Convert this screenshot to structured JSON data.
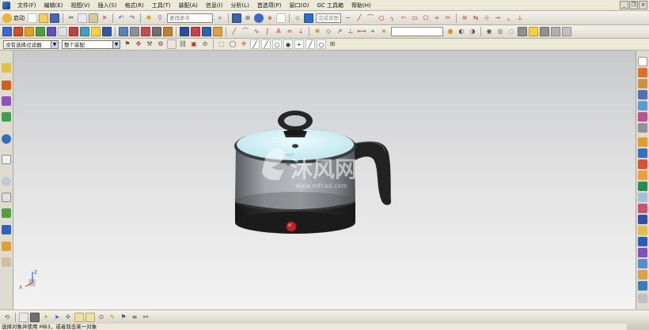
{
  "menubar": {
    "items": [
      "文件(F)",
      "编辑(E)",
      "视图(V)",
      "插入(S)",
      "格式(R)",
      "工具(T)",
      "装配(A)",
      "信息(I)",
      "分析(L)",
      "首选项(P)",
      "窗口(O)",
      "GC 工具箱",
      "帮助(H)"
    ]
  },
  "toolbar1": {
    "start_label": "启动",
    "search_placeholder": "查找命令",
    "sketch_field": "完成草图"
  },
  "toolbar3": {
    "selection_filter": "没有选择过滤器",
    "selection_scope": "整个装配"
  },
  "viewport": {
    "watermark_name": "沐风网",
    "watermark_url": "www.mfcad.com",
    "triad": {
      "x": "X",
      "z": "Z"
    }
  },
  "status": {
    "text": "选择对象并使用 MB3，或者双击某一对象"
  },
  "colors": {
    "accent": "#3a7fd5",
    "pot_body": "#9a9ea3",
    "pot_base": "#2a2a2a",
    "lid_glass": "#d6f1f6",
    "power_button": "#c62222"
  }
}
